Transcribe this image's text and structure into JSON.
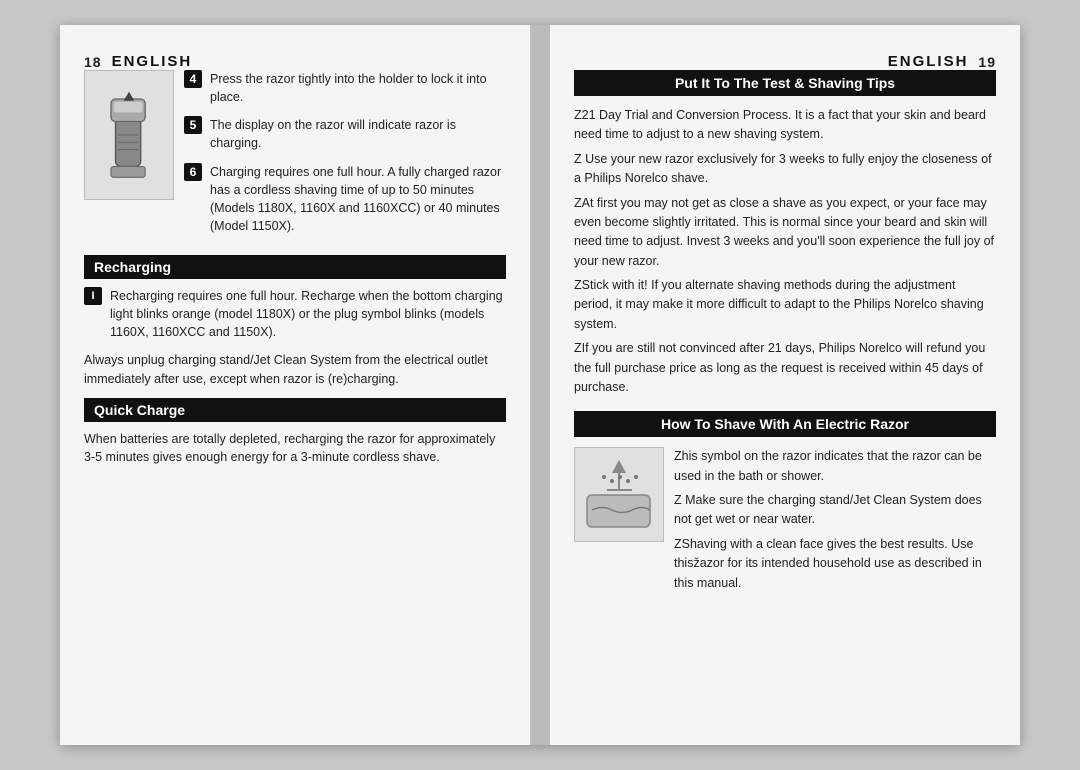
{
  "leftPage": {
    "pageNum": "18",
    "title": "ENGLISH",
    "topSteps": [
      {
        "num": "4",
        "text": "Press the razor tightly into the holder to lock it into place."
      },
      {
        "num": "5",
        "text": "The display on the razor will indicate razor is charging."
      },
      {
        "num": "6",
        "text": "Charging requires one full hour. A fully charged razor has a cordless shaving time of up to 50 minutes (Models 1180X, 1160X and 1160XCC) or 40 minutes (Model 1150X)."
      }
    ],
    "rechargingHeader": "Recharging",
    "rechargingSteps": [
      {
        "num": "I",
        "text": "Recharging requires one full hour. Recharge when the bottom charging light blinks orange (model 1180X) or the plug symbol blinks (models 1160X, 1160XCC and 1150X)."
      }
    ],
    "alwaysUnplug": "Always unplug charging stand/Jet Clean System from the electrical outlet immediately after use, except when razor is (re)charging.",
    "quickChargeHeader": "Quick Charge",
    "quickChargeText": "When batteries are totally depleted, recharging the razor for approximately 3-5 minutes gives enough energy for a 3-minute cordless shave."
  },
  "rightPage": {
    "pageNum": "19",
    "title": "ENGLISH",
    "putItHeader": "Put It To The Test & Shaving Tips",
    "putItText": [
      "Z21 Day Trial and Conversion Process. It is a fact that your skin and beard need time to adjust to a new shaving system.",
      "Z  Use your new razor exclusively for 3 weeks to fully enjoy the closeness of a Philips Norelco shave.",
      "ZAt first you may not get as close a shave as you expect, or your face may even become slightly irritated. This is normal since your beard and skin will need time to adjust. Invest 3 weeks and you'll soon experience the full joy of your new razor.",
      "ZStick with it! If you alternate shaving methods during the adjustment period, it may make it more difficult to adapt to the Philips Norelco shaving system.",
      "ZIf you are still not convinced after 21 days, Philips Norelco will refund you the full purchase price as long as the request is received within 45 days of purchase."
    ],
    "howToHeader": "How To Shave With An Electric Razor",
    "howToText": [
      "Zhis symbol on the razor indicates that the razor can be used in the bath or shower.",
      "Z  Make sure the charging stand/Jet Clean System does not get wet or near water.",
      "ZShaving with a clean face gives the best results. Use thisžazor for its intended household use as described in this manual."
    ]
  }
}
